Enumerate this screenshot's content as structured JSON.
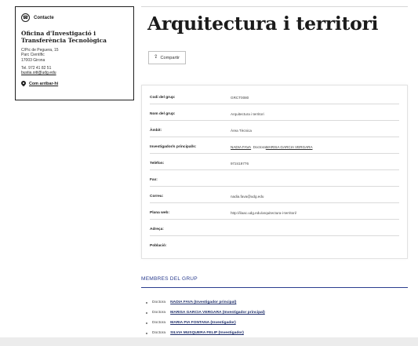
{
  "contact": {
    "title": "Contacte",
    "org": "Oficina d'Investigació i Transferència Tecnològica",
    "address": [
      "C/Pic de Peguera, 15",
      "Parc Científic",
      "17003 Girona"
    ],
    "tel": "Tel. 972 41 82 51",
    "email": "bustia.oitt@udg.edu",
    "howto": "Com arribar-hi"
  },
  "page": {
    "title": "Arquitectura i territori",
    "share_label": "Compartir"
  },
  "info": {
    "rows": [
      {
        "key": "Codi del grup:",
        "value": "GRCT0080"
      },
      {
        "key": "Nom del grup:",
        "value": "Arquitectura i territori"
      },
      {
        "key": "Àmbit:",
        "value": "Àrea Tècnica"
      },
      {
        "key": "Investigador/s principal/s:",
        "value_a": "NADIA FAVA",
        "value_b": "Doctora",
        "value_c": "MARISA GARCIA VERGARA"
      },
      {
        "key": "Telèfon:",
        "value": "972419776"
      },
      {
        "key": "Fax:",
        "value": ""
      },
      {
        "key": "Correu:",
        "value": "nadia.fava@udg.edu"
      },
      {
        "key": "Plana web:",
        "value": "http://ilaac.udg.edu/arquitectura-i-territori/"
      },
      {
        "key": "Adreça:",
        "value": ""
      },
      {
        "key": "Població:",
        "value": ""
      }
    ]
  },
  "members": {
    "title": "MEMBRES DEL GRUP",
    "items": [
      {
        "prefix": "Doctora",
        "name": "NADIA FAVA (Investigador principal)"
      },
      {
        "prefix": "Doctora",
        "name": "MARISA GARCIA VERGARA (Investigador principal)"
      },
      {
        "prefix": "Doctora",
        "name": "MARIA PIA FONTANA (Investigador)"
      },
      {
        "prefix": "Doctora",
        "name": "SILVIA MUSQUERA FELIP (Investigador)"
      }
    ]
  }
}
